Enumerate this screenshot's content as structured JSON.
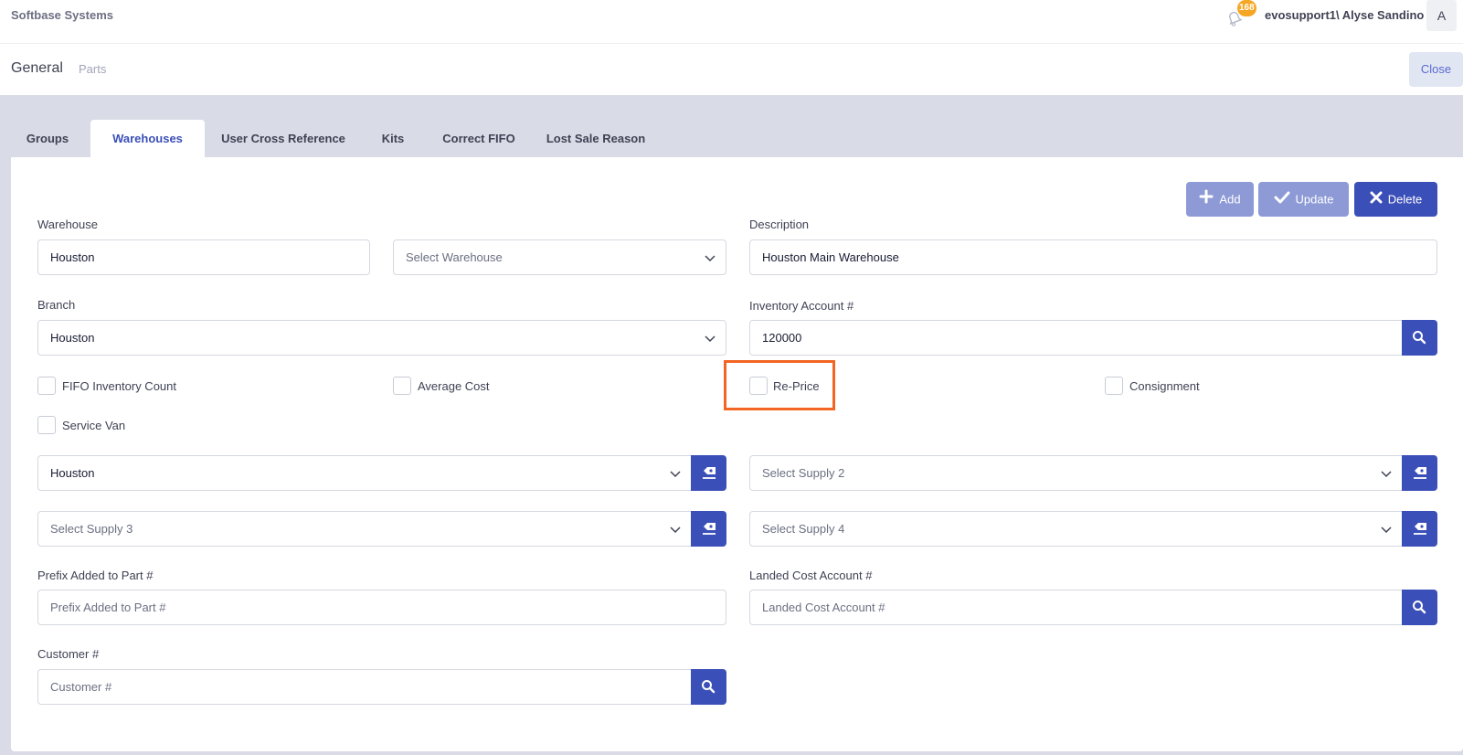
{
  "topbar": {
    "brand": "Softbase Systems",
    "notification_count": "168",
    "username": "evosupport1\\ Alyse Sandino",
    "avatar_initial": "A"
  },
  "header": {
    "title": "General",
    "subtitle": "Parts",
    "close_label": "Close"
  },
  "tabs": [
    {
      "label": "Groups",
      "active": false
    },
    {
      "label": "Warehouses",
      "active": true
    },
    {
      "label": "User Cross Reference",
      "active": false
    },
    {
      "label": "Kits",
      "active": false
    },
    {
      "label": "Correct FIFO",
      "active": false
    },
    {
      "label": "Lost Sale Reason",
      "active": false
    }
  ],
  "actions": {
    "add_label": "Add",
    "update_label": "Update",
    "delete_label": "Delete"
  },
  "form": {
    "warehouse": {
      "label": "Warehouse",
      "value": "Houston",
      "select_placeholder": "Select Warehouse"
    },
    "description": {
      "label": "Description",
      "value": "Houston Main Warehouse"
    },
    "branch": {
      "label": "Branch",
      "value": "Houston"
    },
    "inventory_account": {
      "label": "Inventory Account #",
      "value": "120000"
    },
    "checkboxes": [
      {
        "label": "FIFO Inventory Count",
        "checked": false
      },
      {
        "label": "Average Cost",
        "checked": false
      },
      {
        "label": "Re-Price",
        "checked": false
      },
      {
        "label": "Consignment",
        "checked": false
      },
      {
        "label": "Service Van",
        "checked": false
      }
    ],
    "supply1": {
      "value": "Houston"
    },
    "supply2": {
      "placeholder": "Select Supply 2"
    },
    "supply3": {
      "placeholder": "Select Supply 3"
    },
    "supply4": {
      "placeholder": "Select Supply 4"
    },
    "prefix": {
      "label": "Prefix Added to Part #",
      "placeholder": "Prefix Added to Part #"
    },
    "landed_cost": {
      "label": "Landed Cost Account #",
      "placeholder": "Landed Cost Account #"
    },
    "customer": {
      "label": "Customer #",
      "placeholder": "Customer #"
    }
  },
  "colors": {
    "primary": "#3b4fb8",
    "primary_disabled": "#8d9ad6",
    "highlight": "#f26522",
    "badge": "#f5a623"
  }
}
